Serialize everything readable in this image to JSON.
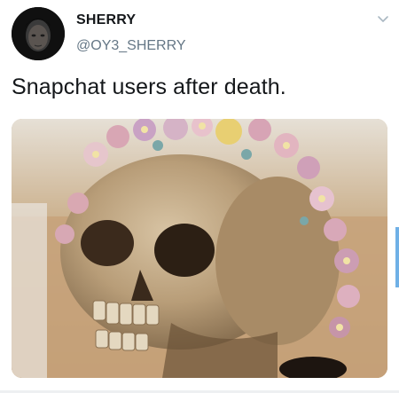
{
  "tweet": {
    "display_name": "SHERRY",
    "handle": "@OY3_SHERRY",
    "text": "Snapchat users after death.",
    "avatar_icon": "profile-avatar",
    "menu_icon": "chevron-down-icon",
    "media_description_icon": "skull-with-flowers-photo"
  },
  "colors": {
    "name": "#14171a",
    "handle": "#657786",
    "text": "#14171a",
    "accent": "#6fb0e6"
  }
}
